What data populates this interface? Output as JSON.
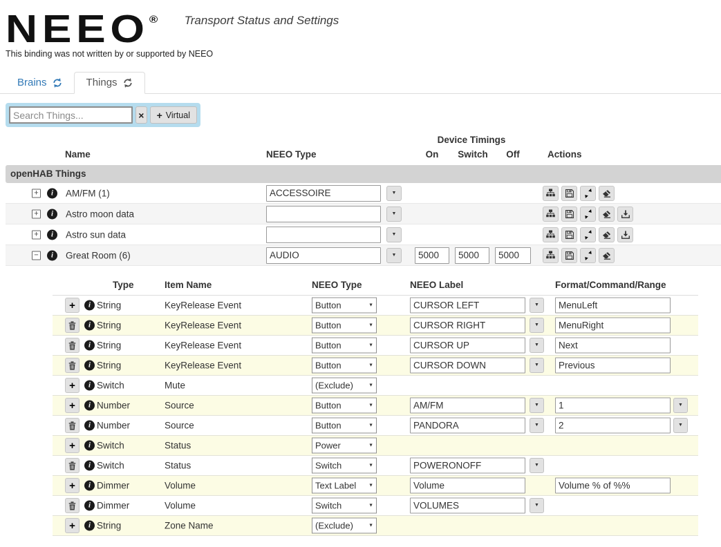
{
  "header": {
    "logo": "NEEO",
    "registered_mark": "®",
    "subtitle": "Transport Status and Settings",
    "disclaimer": "This binding was not written by or supported by NEEO"
  },
  "tabs": [
    {
      "label": "Brains",
      "icon": "refresh-icon",
      "active": false
    },
    {
      "label": "Things",
      "icon": "refresh-icon",
      "active": true
    }
  ],
  "toolbar": {
    "search_placeholder": "Search Things...",
    "clear_icon": "x-icon",
    "clear_glyph": "×",
    "virtual_label": "Virtual",
    "plus_glyph": "+"
  },
  "colors": {
    "accent_blue": "#337ab7",
    "toolbar_bg": "#b5dcee",
    "group_bar_bg": "#d3d3d3",
    "stripe_gray": "#f5f5f5",
    "stripe_yellow": "#fcfce4"
  },
  "things_table": {
    "group_header": "openHAB Things",
    "columns": {
      "name": "Name",
      "neeo_type": "NEEO Type",
      "device_timings": "Device Timings",
      "on": "On",
      "switch": "Switch",
      "off": "Off",
      "actions": "Actions"
    },
    "rows": [
      {
        "expanded": false,
        "name": "AM/FM (1)",
        "neeo_type": "ACCESSOIRE",
        "timings": null,
        "actions": [
          "sitemap",
          "save",
          "refresh",
          "eraser"
        ]
      },
      {
        "expanded": false,
        "name": "Astro moon data",
        "neeo_type": "",
        "timings": null,
        "actions": [
          "sitemap",
          "save",
          "refresh",
          "eraser",
          "download"
        ]
      },
      {
        "expanded": false,
        "name": "Astro sun data",
        "neeo_type": "",
        "timings": null,
        "actions": [
          "sitemap",
          "save",
          "refresh",
          "eraser",
          "download"
        ]
      },
      {
        "expanded": true,
        "name": "Great Room (6)",
        "neeo_type": "AUDIO",
        "timings": {
          "on": "5000",
          "switch": "5000",
          "off": "5000"
        },
        "actions": [
          "sitemap",
          "save",
          "refresh",
          "eraser"
        ]
      }
    ]
  },
  "channels_table": {
    "columns": {
      "type": "Type",
      "item_name": "Item Name",
      "neeo_type": "NEEO Type",
      "neeo_label": "NEEO Label",
      "format": "Format/Command/Range"
    },
    "rows": [
      {
        "action": "add",
        "type": "String",
        "item_name": "KeyRelease Event",
        "neeo_type": "Button",
        "neeo_label": "CURSOR LEFT",
        "label_dropdown": true,
        "format": "MenuLeft",
        "format_dropdown": false
      },
      {
        "action": "delete",
        "type": "String",
        "item_name": "KeyRelease Event",
        "neeo_type": "Button",
        "neeo_label": "CURSOR RIGHT",
        "label_dropdown": true,
        "format": "MenuRight",
        "format_dropdown": false
      },
      {
        "action": "delete",
        "type": "String",
        "item_name": "KeyRelease Event",
        "neeo_type": "Button",
        "neeo_label": "CURSOR UP",
        "label_dropdown": true,
        "format": "Next",
        "format_dropdown": false
      },
      {
        "action": "delete",
        "type": "String",
        "item_name": "KeyRelease Event",
        "neeo_type": "Button",
        "neeo_label": "CURSOR DOWN",
        "label_dropdown": true,
        "format": "Previous",
        "format_dropdown": false
      },
      {
        "action": "add",
        "type": "Switch",
        "item_name": "Mute",
        "neeo_type": "(Exclude)",
        "neeo_label": null,
        "label_dropdown": false,
        "format": null,
        "format_dropdown": false
      },
      {
        "action": "add",
        "type": "Number",
        "item_name": "Source",
        "neeo_type": "Button",
        "neeo_label": "AM/FM",
        "label_dropdown": true,
        "format": "1",
        "format_dropdown": true
      },
      {
        "action": "delete",
        "type": "Number",
        "item_name": "Source",
        "neeo_type": "Button",
        "neeo_label": "PANDORA",
        "label_dropdown": true,
        "format": "2",
        "format_dropdown": true
      },
      {
        "action": "add",
        "type": "Switch",
        "item_name": "Status",
        "neeo_type": "Power",
        "neeo_label": null,
        "label_dropdown": false,
        "format": null,
        "format_dropdown": false
      },
      {
        "action": "delete",
        "type": "Switch",
        "item_name": "Status",
        "neeo_type": "Switch",
        "neeo_label": "POWERONOFF",
        "label_dropdown": true,
        "format": null,
        "format_dropdown": false
      },
      {
        "action": "add",
        "type": "Dimmer",
        "item_name": "Volume",
        "neeo_type": "Text Label",
        "neeo_label": "Volume",
        "label_dropdown": false,
        "format": "Volume % of %%",
        "format_dropdown": false
      },
      {
        "action": "delete",
        "type": "Dimmer",
        "item_name": "Volume",
        "neeo_type": "Switch",
        "neeo_label": "VOLUMES",
        "label_dropdown": true,
        "format": null,
        "format_dropdown": false
      },
      {
        "action": "add",
        "type": "String",
        "item_name": "Zone Name",
        "neeo_type": "(Exclude)",
        "neeo_label": null,
        "label_dropdown": false,
        "format": null,
        "format_dropdown": false
      }
    ]
  }
}
